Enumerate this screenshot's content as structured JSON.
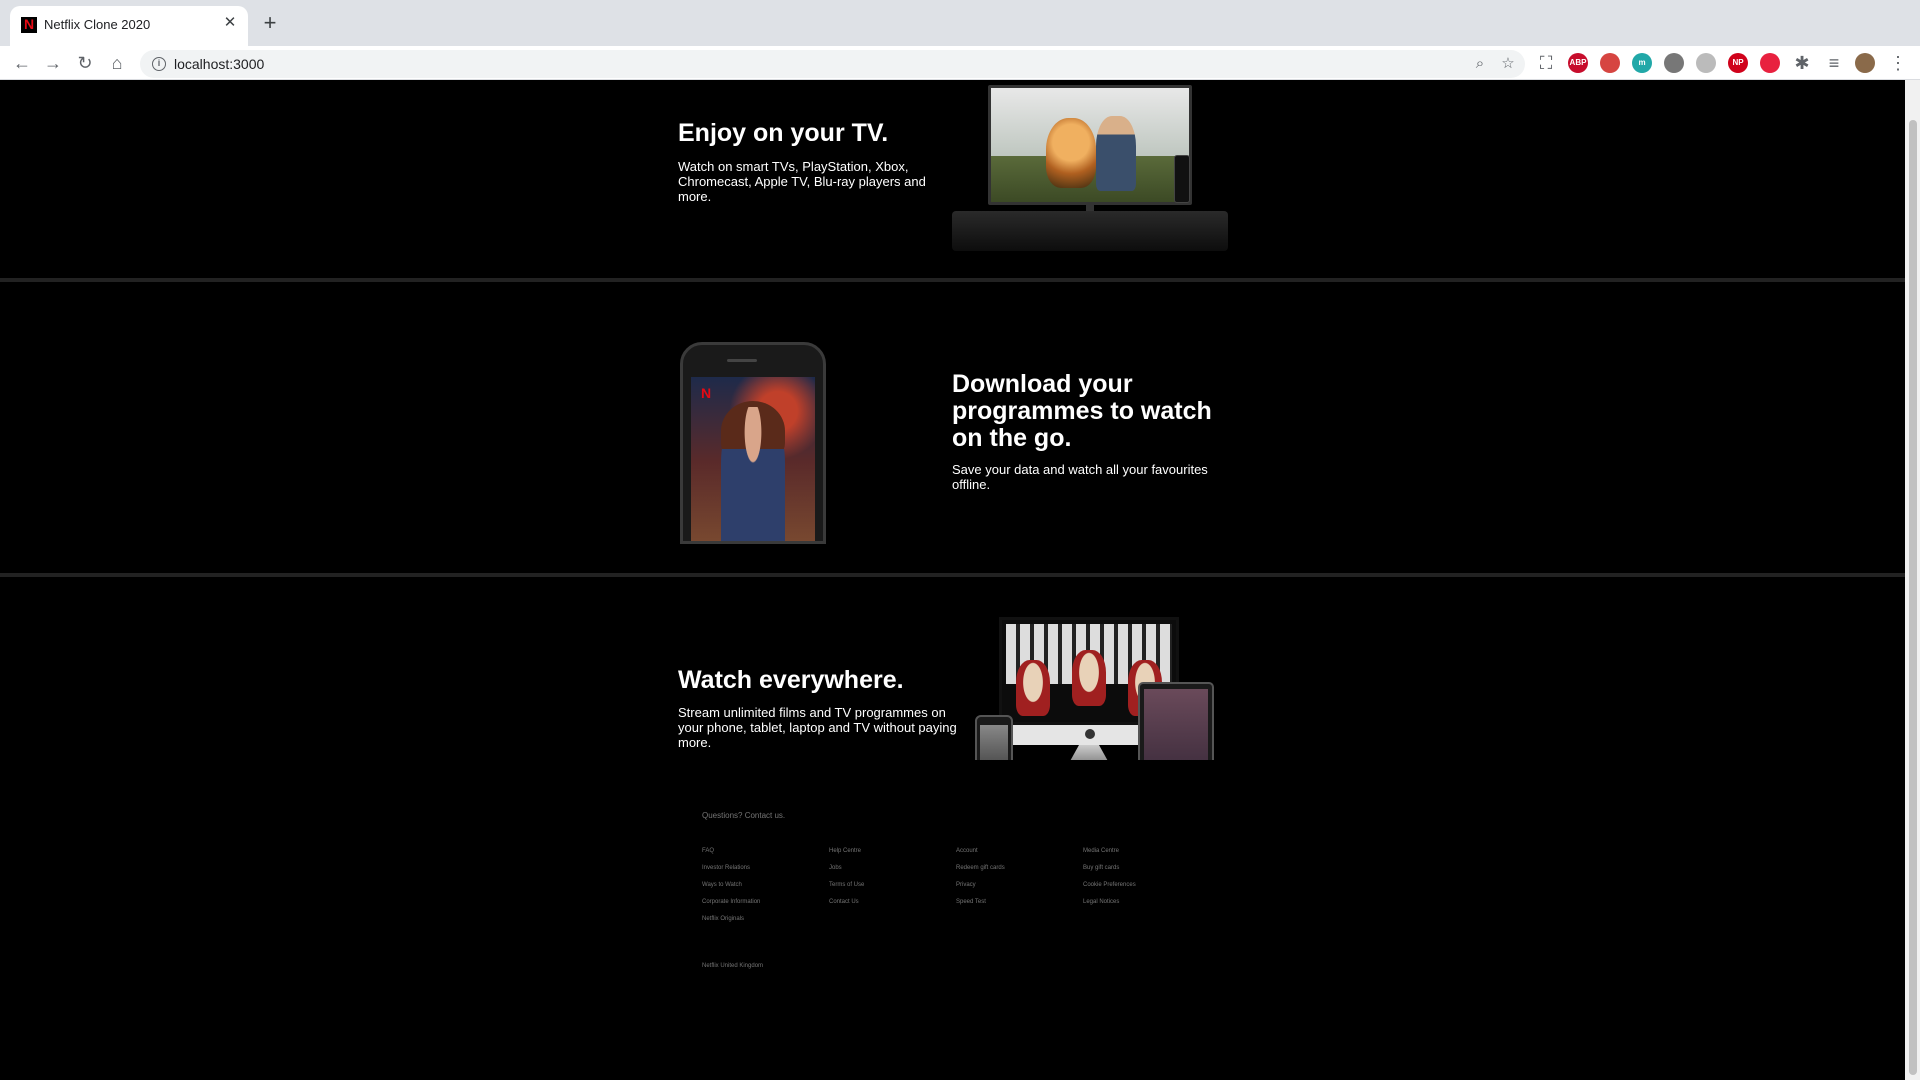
{
  "browser": {
    "tab_title": "Netflix Clone 2020",
    "tab_close": "✕",
    "new_tab": "+",
    "url": "localhost:3000",
    "info_icon": "i",
    "extensions": [
      {
        "name": "ABP",
        "color": "#c70d2c"
      },
      {
        "name": "",
        "color": "#d64541"
      },
      {
        "name": "m",
        "color": "#21a8a8"
      },
      {
        "name": "",
        "color": "#777777"
      },
      {
        "name": "",
        "color": "#bbbbbb"
      },
      {
        "name": "NP",
        "color": "#d0021b"
      },
      {
        "name": "",
        "color": "#e8213f"
      }
    ]
  },
  "stories": [
    {
      "title": "Enjoy on your TV.",
      "text": "Watch on smart TVs, PlayStation, Xbox, Chromecast, Apple TV, Blu-ray players and more."
    },
    {
      "title": "Download your programmes to watch on the go.",
      "text": "Save your data and watch all your favourites offline."
    },
    {
      "title": "Watch everywhere.",
      "text": "Stream unlimited films and TV programmes on your phone, tablet, laptop and TV without paying more."
    }
  ],
  "phone_logo": "N",
  "footer": {
    "contact": "Questions? Contact us.",
    "columns": [
      [
        "FAQ",
        "Investor Relations",
        "Ways to Watch",
        "Corporate Information",
        "Netflix Originals"
      ],
      [
        "Help Centre",
        "Jobs",
        "Terms of Use",
        "Contact Us"
      ],
      [
        "Account",
        "Redeem gift cards",
        "Privacy",
        "Speed Test"
      ],
      [
        "Media Centre",
        "Buy gift cards",
        "Cookie Preferences",
        "Legal Notices"
      ]
    ],
    "country": "Netflix United Kingdom"
  }
}
